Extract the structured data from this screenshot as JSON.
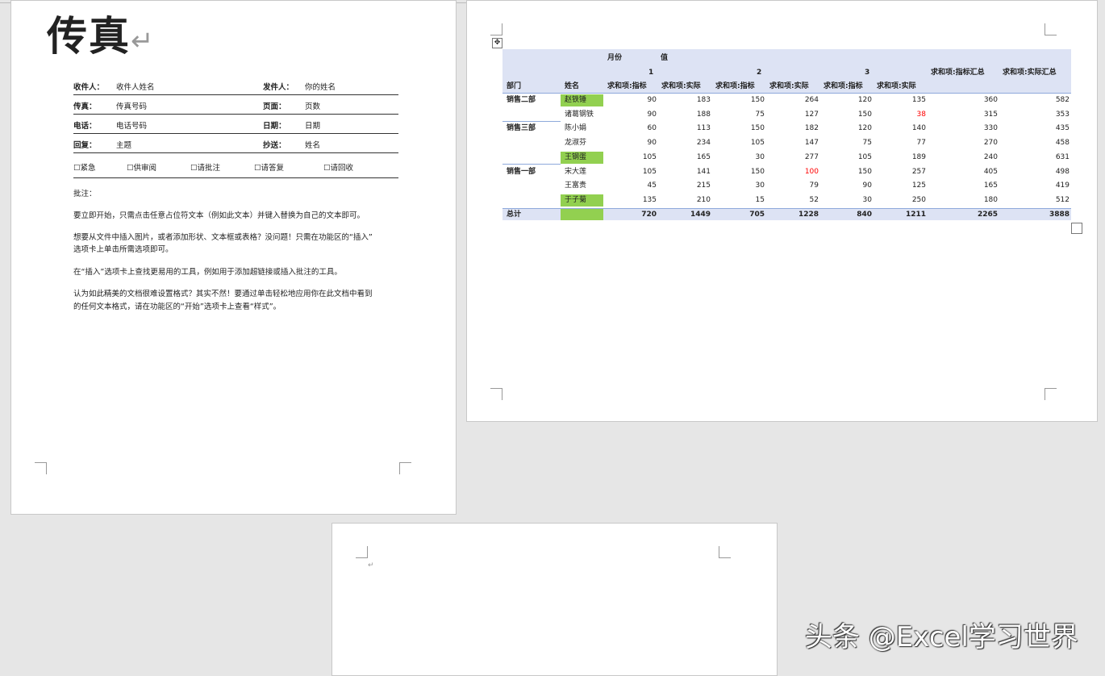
{
  "fax": {
    "title": "传真",
    "pilcrow": "↵",
    "to_label": "收件人：",
    "to_value": "收件人姓名",
    "from_label": "发件人：",
    "from_value": "你的姓名",
    "fax_label": "传真：",
    "fax_value": "传真号码",
    "pages_label": "页面：",
    "pages_value": "页数",
    "phone_label": "电话：",
    "phone_value": "电话号码",
    "date_label": "日期：",
    "date_value": "日期",
    "re_label": "回复：",
    "re_value": "主题",
    "cc_label": "抄送：",
    "cc_value": "姓名",
    "checks": [
      "☐紧急",
      "☐供审阅",
      "☐请批注",
      "☐请答复",
      "☐请回收"
    ],
    "comments_label": "批注：",
    "para1": "要立即开始，只需点击任意占位符文本（例如此文本）并键入替换为自己的文本即可。",
    "para2a": "想要从文件中插入图片，或者添加形状、文本框或表格？没问题！只需在功能区的“插入”",
    "para2b": "选项卡上单击所需选项即可。",
    "para3": "在“插入”选项卡上查找更易用的工具，例如用于添加超链接或插入批注的工具。",
    "para4a": "认为如此精美的文档很难设置格式？其实不然！要通过单击轻松地应用你在此文档中看到",
    "para4b": "的任何文本格式，请在功能区的“开始”选项卡上查看“样式”。"
  },
  "pivot": {
    "month_label": "月份",
    "value_label": "值",
    "months": [
      "1",
      "2",
      "3"
    ],
    "grand_target_header": "求和项:指标汇总",
    "grand_actual_header": "求和项:实际汇总",
    "dept_header": "部门",
    "name_header": "姓名",
    "target_header": "求和项:指标",
    "actual_header": "求和项:实际",
    "rows": [
      {
        "dept": "销售二部",
        "name": "赵铁锤",
        "v": [
          "90",
          "183",
          "150",
          "264",
          "120",
          "135",
          "360",
          "582"
        ]
      },
      {
        "dept": "",
        "name": "诸葛钢铁",
        "v": [
          "90",
          "188",
          "75",
          "127",
          "150",
          "38",
          "315",
          "353"
        ]
      },
      {
        "dept": "销售三部",
        "name": "陈小娟",
        "v": [
          "60",
          "113",
          "150",
          "182",
          "120",
          "140",
          "330",
          "435"
        ]
      },
      {
        "dept": "",
        "name": "龙淑芬",
        "v": [
          "90",
          "234",
          "105",
          "147",
          "75",
          "77",
          "270",
          "458"
        ]
      },
      {
        "dept": "",
        "name": "王钢蛋",
        "v": [
          "105",
          "165",
          "30",
          "277",
          "105",
          "189",
          "240",
          "631"
        ]
      },
      {
        "dept": "销售一部",
        "name": "宋大莲",
        "v": [
          "105",
          "141",
          "150",
          "100",
          "150",
          "257",
          "405",
          "498"
        ]
      },
      {
        "dept": "",
        "name": "王富贵",
        "v": [
          "45",
          "215",
          "30",
          "79",
          "90",
          "125",
          "165",
          "419"
        ]
      },
      {
        "dept": "",
        "name": "于子菊",
        "v": [
          "135",
          "210",
          "15",
          "52",
          "30",
          "250",
          "180",
          "512"
        ]
      }
    ],
    "total_label": "总计",
    "totals": [
      "720",
      "1449",
      "705",
      "1228",
      "840",
      "1211",
      "2265",
      "3888"
    ],
    "highlight_color": "#92d050",
    "red_color": "#ff0000",
    "band_color": "#dde3f4"
  },
  "watermark": "头条 @Excel学习世界"
}
